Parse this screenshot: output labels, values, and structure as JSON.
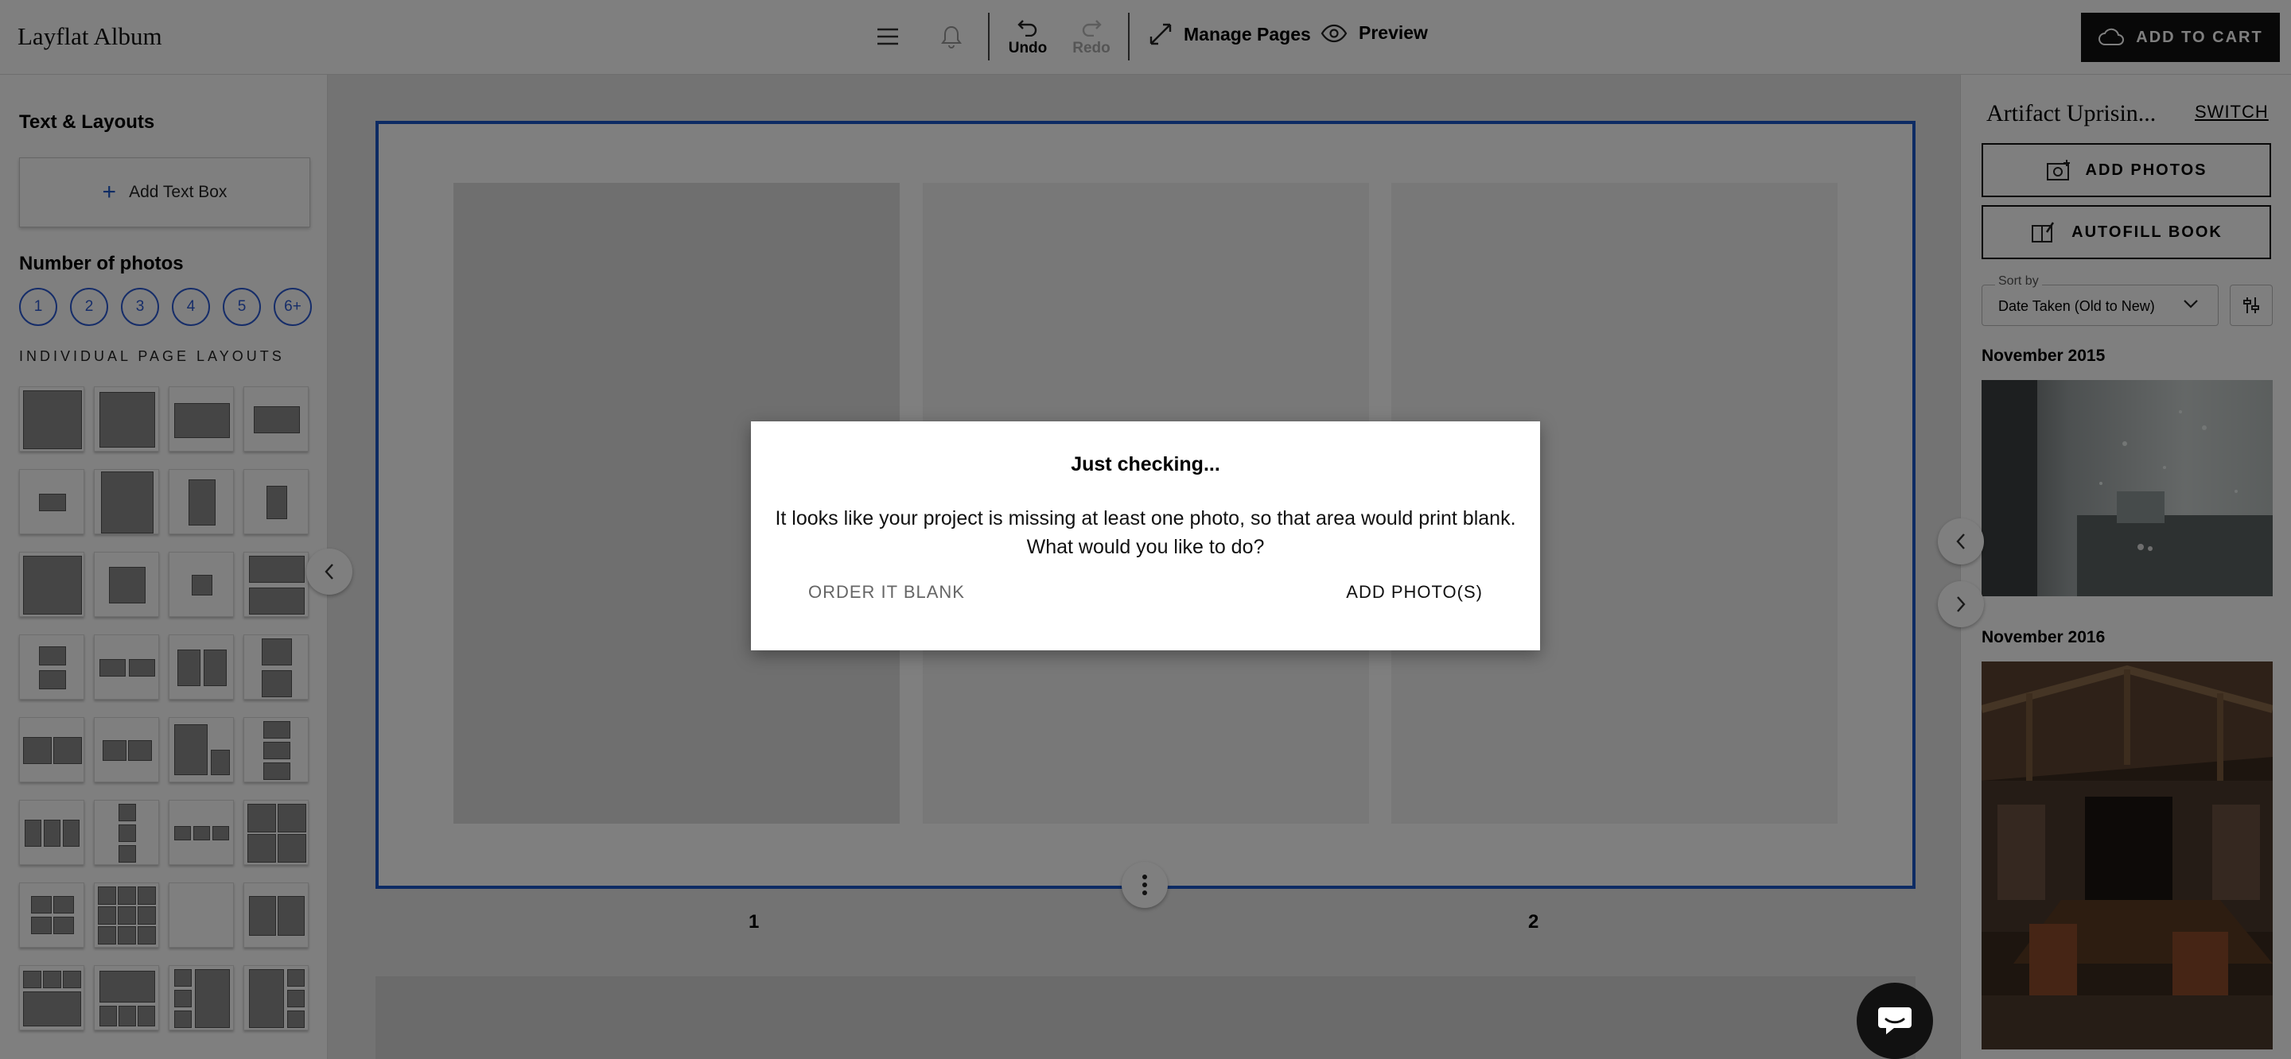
{
  "header": {
    "brand": "Layflat Album",
    "undo_label": "Undo",
    "redo_label": "Redo",
    "manage_pages_label": "Manage Pages",
    "preview_label": "Preview",
    "cart_label": "ADD TO CART"
  },
  "left_panel": {
    "title": "Text & Layouts",
    "add_text_label": "Add Text Box",
    "num_photos_title": "Number of photos",
    "num_options": [
      "1",
      "2",
      "3",
      "4",
      "5",
      "6+"
    ],
    "individual_layouts_title": "INDIVIDUAL PAGE LAYOUTS"
  },
  "canvas": {
    "page_numbers": [
      "1",
      "2"
    ]
  },
  "right_panel": {
    "project_name": "Artifact Uprisin...",
    "switch_label": "SWITCH",
    "add_photos_label": "ADD PHOTOS",
    "autofill_label": "AUTOFILL BOOK",
    "sort_label": "Sort by",
    "sort_value": "Date Taken (Old to New)",
    "groups": [
      "November 2015",
      "November 2016"
    ]
  },
  "modal": {
    "title": "Just checking...",
    "body_line1": "It looks like your project is missing at least one photo, so that area would print blank.",
    "body_line2": "What would you like to do?",
    "order_blank_label": "ORDER IT BLANK",
    "add_photos_label": "ADD PHOTO(S)"
  },
  "colors": {
    "accent": "#1a57c9",
    "dark": "#111111",
    "overlay": "#000000"
  }
}
